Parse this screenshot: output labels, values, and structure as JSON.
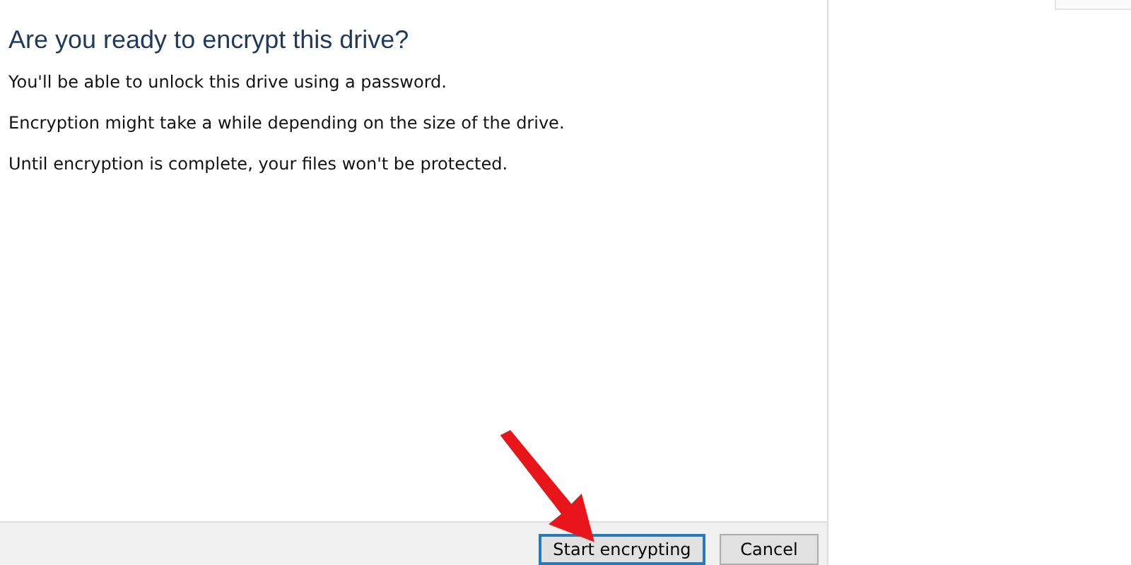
{
  "dialog": {
    "heading": "Are you ready to encrypt this drive?",
    "paragraphs": [
      "You'll be able to unlock this drive using a password.",
      "Encryption might take a while depending on the size of the drive.",
      "Until encryption is complete, your files won't be protected."
    ],
    "buttons": [
      {
        "label": "Start encrypting",
        "default": true
      },
      {
        "label": "Cancel",
        "default": false
      }
    ]
  }
}
